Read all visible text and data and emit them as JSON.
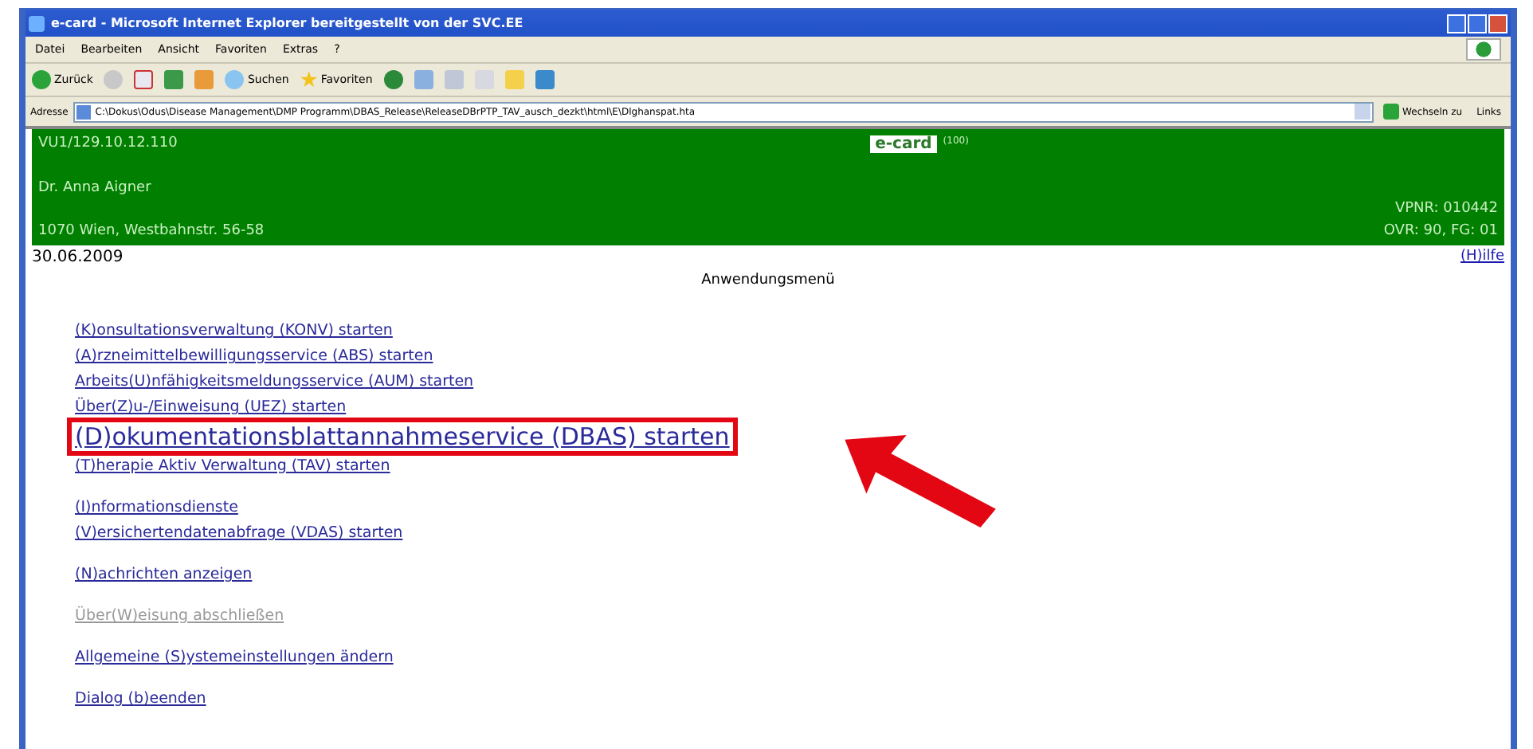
{
  "window": {
    "title": "e-card - Microsoft Internet Explorer bereitgestellt von der SVC.EE"
  },
  "menu": [
    "Datei",
    "Bearbeiten",
    "Ansicht",
    "Favoriten",
    "Extras",
    "?"
  ],
  "toolbar": {
    "back": "Zurück",
    "search": "Suchen",
    "favorites": "Favoriten"
  },
  "address_bar": {
    "label": "Adresse",
    "value": "C:\\Dokus\\Odus\\Disease Management\\DMP Programm\\DBAS_Release\\ReleaseDBrPTP_TAV_ausch_dezkt\\html\\E\\Dlghanspat.hta",
    "go": "Wechseln zu",
    "links": "Links"
  },
  "header": {
    "left": [
      "VU1/129.10.12.110",
      "Dr. Anna Aigner",
      "1070 Wien, Westbahnstr. 56-58"
    ],
    "logo": "e-card",
    "logo_note": "(100)",
    "right": [
      "VPNR: 010442",
      "OVR: 90, FG: 01"
    ]
  },
  "date": "30.06.2009",
  "help": "(H)ilfe",
  "heading": "Anwendungsmenü",
  "link_groups": [
    [
      {
        "label": "(K)onsultationsverwaltung (KONV) starten",
        "disabled": false,
        "highlighted": false
      },
      {
        "label": "(A)rzneimittelbewilligungsservice (ABS) starten",
        "disabled": false,
        "highlighted": false
      },
      {
        "label": "Arbeits(U)nfähigkeitsmeldungsservice (AUM) starten",
        "disabled": false,
        "highlighted": false
      },
      {
        "label": "Über(Z)u-/Einweisung (UEZ) starten",
        "disabled": false,
        "highlighted": false
      },
      {
        "label": "(D)okumentationsblattannahmeservice (DBAS) starten",
        "disabled": false,
        "highlighted": true
      },
      {
        "label": "(T)herapie Aktiv Verwaltung (TAV) starten",
        "disabled": false,
        "highlighted": false
      }
    ],
    [
      {
        "label": "(I)nformationsdienste",
        "disabled": false,
        "highlighted": false
      },
      {
        "label": "(V)ersichertendatenabfrage (VDAS) starten",
        "disabled": false,
        "highlighted": false
      }
    ],
    [
      {
        "label": "(N)achrichten anzeigen",
        "disabled": false,
        "highlighted": false
      }
    ],
    [
      {
        "label": "Über(W)eisung abschließen",
        "disabled": true,
        "highlighted": false
      }
    ],
    [
      {
        "label": "Allgemeine (S)ystemeinstellungen ändern",
        "disabled": false,
        "highlighted": false
      }
    ],
    [
      {
        "label": "Dialog (b)eenden",
        "disabled": false,
        "highlighted": false
      }
    ]
  ]
}
